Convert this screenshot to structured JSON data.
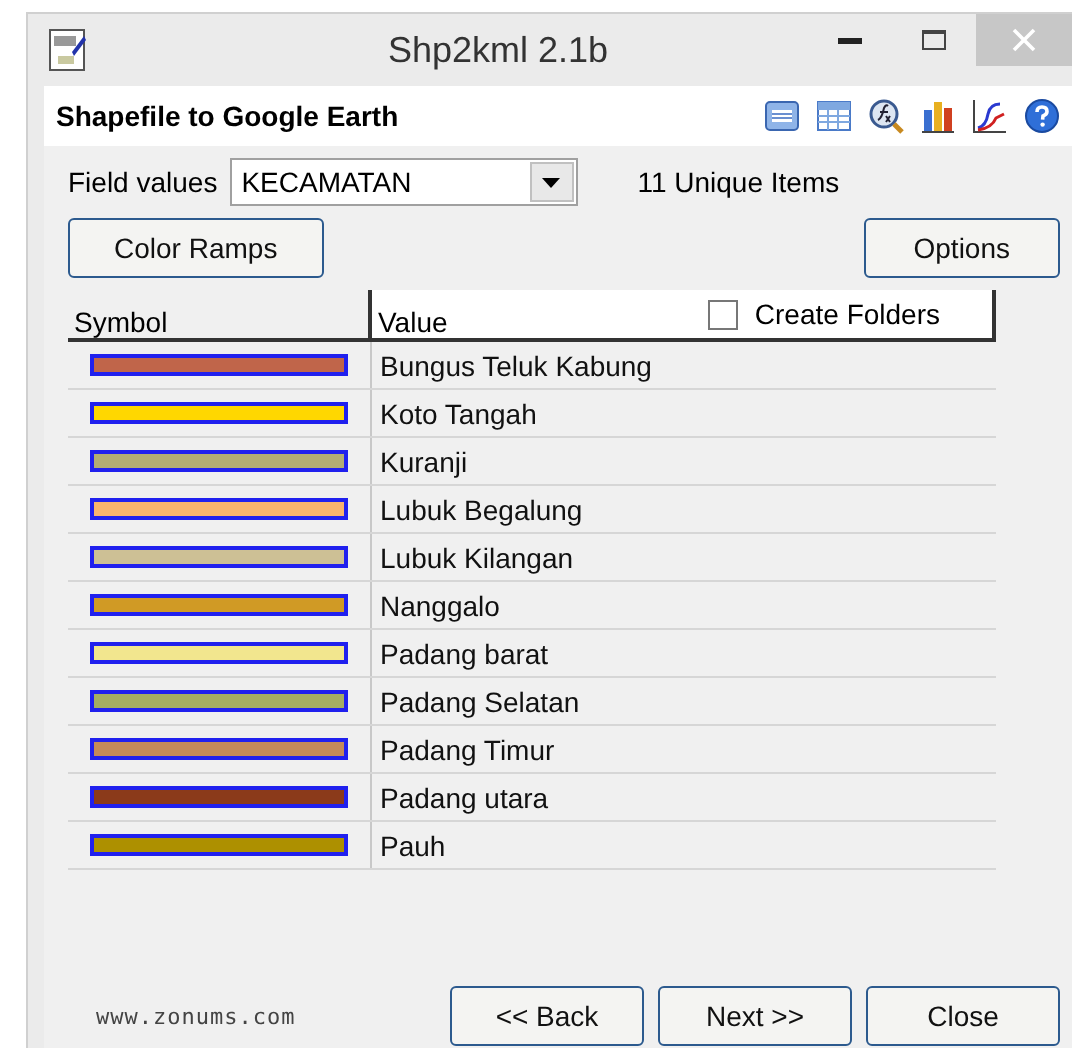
{
  "window": {
    "title": "Shp2kml 2.1b"
  },
  "header": {
    "title": "Shapefile to Google Earth"
  },
  "field": {
    "label": "Field values",
    "value": "KECAMATAN",
    "count": "11 Unique Items"
  },
  "buttons_top": [
    "Color Ramps",
    "Options"
  ],
  "table": {
    "columns": [
      "Symbol",
      "Value"
    ],
    "create_folders": {
      "label": "Create Folders",
      "checked": false
    },
    "rows": [
      {
        "value": "Bungus Teluk Kabung",
        "color": "#c0654a"
      },
      {
        "value": "Koto Tangah",
        "color": "#ffd700"
      },
      {
        "value": "Kuranji",
        "color": "#b3ad74"
      },
      {
        "value": "Lubuk Begalung",
        "color": "#f9b46e"
      },
      {
        "value": "Lubuk Kilangan",
        "color": "#cdc095"
      },
      {
        "value": "Nanggalo",
        "color": "#d09a25"
      },
      {
        "value": "Padang barat",
        "color": "#f2e68e"
      },
      {
        "value": "Padang Selatan",
        "color": "#a6ae62"
      },
      {
        "value": "Padang Timur",
        "color": "#c48a5a"
      },
      {
        "value": "Padang utara",
        "color": "#8b3a1a"
      },
      {
        "value": "Pauh",
        "color": "#ad9000"
      }
    ]
  },
  "website": "www.zonums.com",
  "buttons_bottom": [
    "<< Back",
    "Next >>",
    "Close"
  ]
}
